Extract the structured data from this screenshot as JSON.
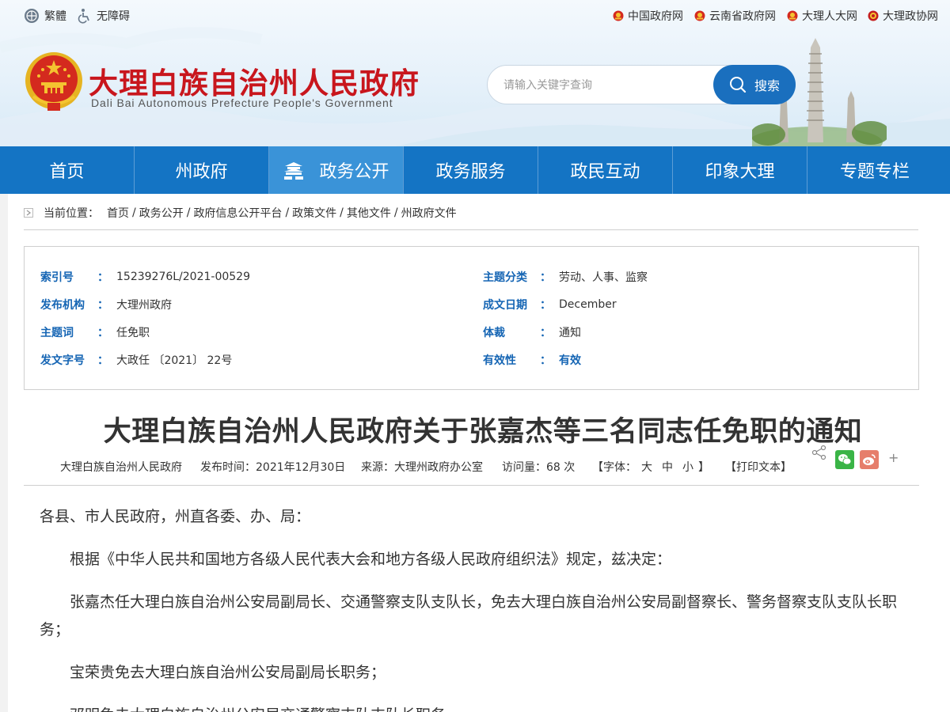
{
  "topbar": {
    "traditional_label": "繁體",
    "accessibility_label": "无障碍",
    "external_links": [
      {
        "label": "中国政府网"
      },
      {
        "label": "云南省政府网"
      },
      {
        "label": "大理人大网"
      },
      {
        "label": "大理政协网"
      }
    ]
  },
  "site": {
    "title": "大理白族自治州人民政府",
    "subtitle": "Dali Bai Autonomous Prefecture People's Government"
  },
  "search": {
    "placeholder": "请输入关键字查询",
    "button_label": "搜索"
  },
  "nav": {
    "items": [
      {
        "label": "首页"
      },
      {
        "label": "州政府"
      },
      {
        "label": "政务公开"
      },
      {
        "label": "政务服务"
      },
      {
        "label": "政民互动"
      },
      {
        "label": "印象大理"
      },
      {
        "label": "专题专栏"
      }
    ],
    "active": "政务公开"
  },
  "breadcrumb": {
    "label": "当前位置：",
    "items": [
      "首页",
      "政务公开",
      "政府信息公开平台",
      "政策文件",
      "其他文件",
      "州政府文件"
    ],
    "separator": "/"
  },
  "meta": {
    "colon": "：",
    "left": [
      {
        "label": "索引号",
        "value": "15239276L/2021-00529"
      },
      {
        "label": "发布机构",
        "value": "大理州政府"
      },
      {
        "label": "主题词",
        "value": "任免职"
      },
      {
        "label": "发文字号",
        "value": "大政任 〔2021〕 22号"
      }
    ],
    "right": [
      {
        "label": "主题分类",
        "value": "劳动、人事、监察"
      },
      {
        "label": "成文日期",
        "value": "December"
      },
      {
        "label": "体裁",
        "value": "通知"
      },
      {
        "label": "有效性",
        "value": "有效"
      }
    ]
  },
  "article": {
    "title": "大理白族自治州人民政府关于张嘉杰等三名同志任免职的通知",
    "publisher": "大理白族自治州人民政府",
    "publish_time": "发布时间：2021年12月30日",
    "source": "来源：大理州政府办公室",
    "visits": "访问量：68 次",
    "font_label_open": "【字体：",
    "font_large": "大",
    "font_medium": "中",
    "font_small": "小",
    "font_label_close": "】",
    "print_label": "【打印文本】",
    "paragraphs": [
      "各县、市人民政府，州直各委、办、局：",
      "根据《中华人民共和国地方各级人民代表大会和地方各级人民政府组织法》规定，兹决定：",
      "张嘉杰任大理白族自治州公安局副局长、交通警察支队支队长，免去大理白族自治州公安局副督察长、警务督察支队支队长职务；",
      "宝荣贵免去大理白族自治州公安局副局长职务；",
      "邓明免去大理白族自治州公安局交通警察支队支队长职务。"
    ]
  },
  "colors": {
    "nav_blue": "#1474c4",
    "nav_active": "#3a93d8",
    "title_red": "#c8161d",
    "label_blue": "#1565b4",
    "wechat_green": "#3ab446",
    "weibo_red": "#e67e6b"
  },
  "icons": {
    "traditional": "globe-icon",
    "accessibility": "wheelchair-icon",
    "external": "national-emblem-icon",
    "search": "magnifier-icon",
    "nav_active": "tiananmen-icon",
    "breadcrumb": "location-arrow-icon",
    "share": "share-icon",
    "wechat": "wechat-icon",
    "weibo": "weibo-icon"
  }
}
